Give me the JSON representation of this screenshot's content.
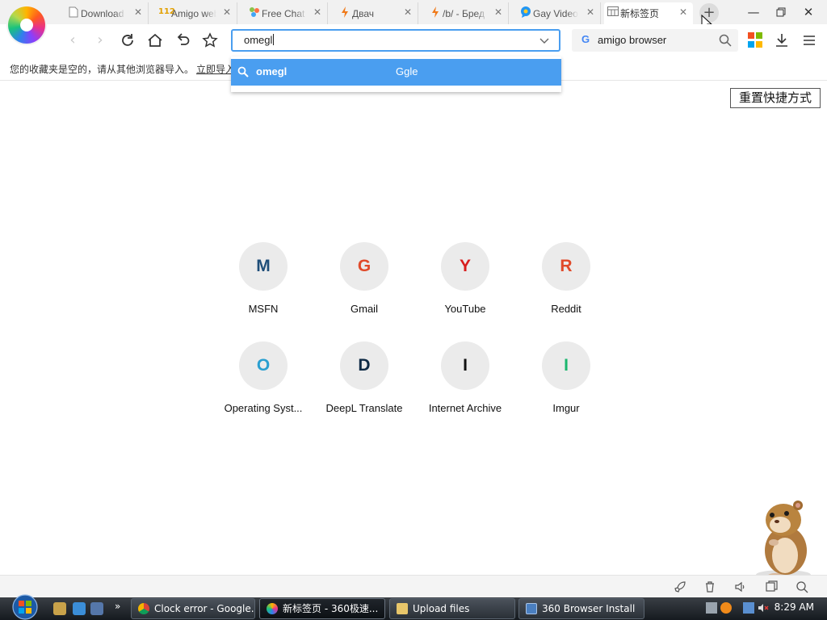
{
  "tabs": [
    {
      "title": "Download",
      "favicon": "document-icon"
    },
    {
      "title": "Amigo web",
      "favicon": "amigo-icon"
    },
    {
      "title": "Free Chat",
      "favicon": "chat-icon"
    },
    {
      "title": "Двач",
      "favicon": "lightning-icon"
    },
    {
      "title": "/b/ - Бред",
      "favicon": "lightning-icon"
    },
    {
      "title": "Gay Video",
      "favicon": "speech-bubble-icon"
    },
    {
      "title": "新标签页",
      "favicon": "grid-icon",
      "active": true
    }
  ],
  "toolbar": {
    "address_value": "omegl",
    "search_query": "amigo browser",
    "search_engine_glyph": "G"
  },
  "bookmarks_bar": {
    "message": "您的收藏夹是空的，请从其他浏览器导入。",
    "import_link": "立即导入"
  },
  "suggestion": {
    "term": "omegl",
    "hint": "Ggle"
  },
  "reset_button": "重置快捷方式",
  "speed_dials": [
    {
      "letter": "M",
      "label": "MSFN",
      "color": "#1f4e79"
    },
    {
      "letter": "G",
      "label": "Gmail",
      "color": "#e04a2a"
    },
    {
      "letter": "Y",
      "label": "YouTube",
      "color": "#d81e1e"
    },
    {
      "letter": "R",
      "label": "Reddit",
      "color": "#e04a2a"
    },
    {
      "letter": "O",
      "label": "Operating Syst...",
      "color": "#2a9fd0"
    },
    {
      "letter": "D",
      "label": "DeepL Translate",
      "color": "#0f2b46"
    },
    {
      "letter": "I",
      "label": "Internet Archive",
      "color": "#111111"
    },
    {
      "letter": "I",
      "label": "Imgur",
      "color": "#1bb76e"
    }
  ],
  "taskbar": {
    "buttons": [
      {
        "label": "Clock error - Google...",
        "icon": "chrome-icon"
      },
      {
        "label": "新标签页 - 360极速...",
        "icon": "360-browser-icon",
        "active": true
      },
      {
        "label": "Upload files",
        "icon": "folder-icon"
      },
      {
        "label": "360 Browser Install",
        "icon": "installer-icon"
      }
    ],
    "clock": "8:29 AM"
  },
  "colors": {
    "accent": "#4a9ef0",
    "tabstrip_bg": "#f1f1f1",
    "taskbar_bg": "#1c2127"
  }
}
